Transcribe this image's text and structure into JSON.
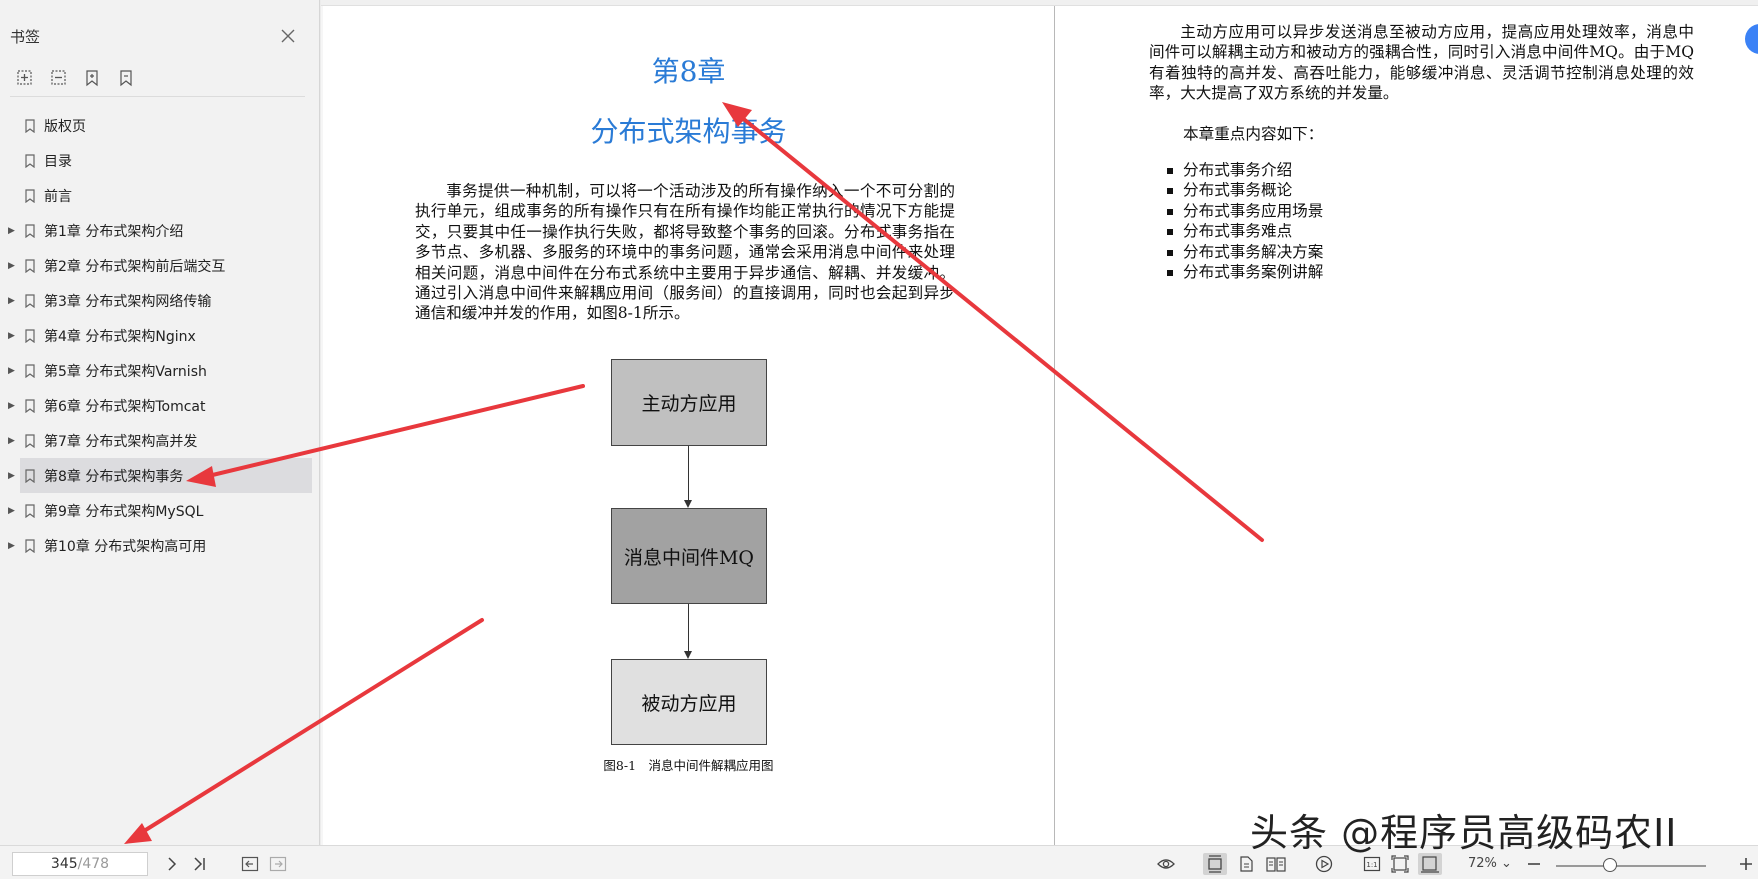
{
  "sidebar": {
    "title": "书签",
    "bookmarks": [
      {
        "label": "版权页",
        "expandable": false
      },
      {
        "label": "目录",
        "expandable": false
      },
      {
        "label": "前言",
        "expandable": false
      },
      {
        "label": "第1章 分布式架构介绍",
        "expandable": true
      },
      {
        "label": "第2章 分布式架构前后端交互",
        "expandable": true
      },
      {
        "label": "第3章 分布式架构网络传输",
        "expandable": true
      },
      {
        "label": "第4章 分布式架构Nginx",
        "expandable": true
      },
      {
        "label": "第5章 分布式架构Varnish",
        "expandable": true
      },
      {
        "label": "第6章 分布式架构Tomcat",
        "expandable": true
      },
      {
        "label": "第7章 分布式架构高并发",
        "expandable": true
      },
      {
        "label": "第8章 分布式架构事务",
        "expandable": true,
        "active": true
      },
      {
        "label": "第9章 分布式架构MySQL",
        "expandable": true
      },
      {
        "label": "第10章 分布式架构高可用",
        "expandable": true
      }
    ]
  },
  "page_left": {
    "chapter_number": "第8章",
    "chapter_title": "分布式架构事务",
    "intro": "事务提供一种机制，可以将一个活动涉及的所有操作纳入一个不可分割的执行单元，组成事务的所有操作只有在所有操作均能正常执行的情况下方能提交，只要其中任一操作执行失败，都将导致整个事务的回滚。分布式事务指在多节点、多机器、多服务的环境中的事务问题，通常会采用消息中间件来处理相关问题，消息中间件在分布式系统中主要用于异步通信、解耦、并发缓冲。通过引入消息中间件来解耦应用间（服务间）的直接调用，同时也会起到异步通信和缓冲并发的作用，如图8-1所示。",
    "figure": {
      "box1": "主动方应用",
      "box2": "消息中间件MQ",
      "box3": "被动方应用",
      "caption": "图8-1　消息中间件解耦应用图"
    }
  },
  "page_right": {
    "paragraph": "主动方应用可以异步发送消息至被动方应用，提高应用处理效率，消息中间件可以解耦主动方和被动方的强耦合性，同时引入消息中间件MQ。由于MQ有着独特的高并发、高吞吐能力，能够缓冲消息、灵活调节控制消息处理的效率，大大提高了双方系统的并发量。",
    "key_points_heading": "本章重点内容如下：",
    "key_points": [
      "分布式事务介绍",
      "分布式事务概论",
      "分布式事务应用场景",
      "分布式事务难点",
      "分布式事务解决方案",
      "分布式事务案例讲解"
    ]
  },
  "bottombar": {
    "current_page": "345",
    "total_pages": "/478",
    "zoom": "72%",
    "zoom_level": 0.36
  },
  "watermark": "头条 @程序员高级码农II",
  "colors": {
    "accent_blue": "#2a7bd6",
    "annotation_red": "#e8383d"
  }
}
